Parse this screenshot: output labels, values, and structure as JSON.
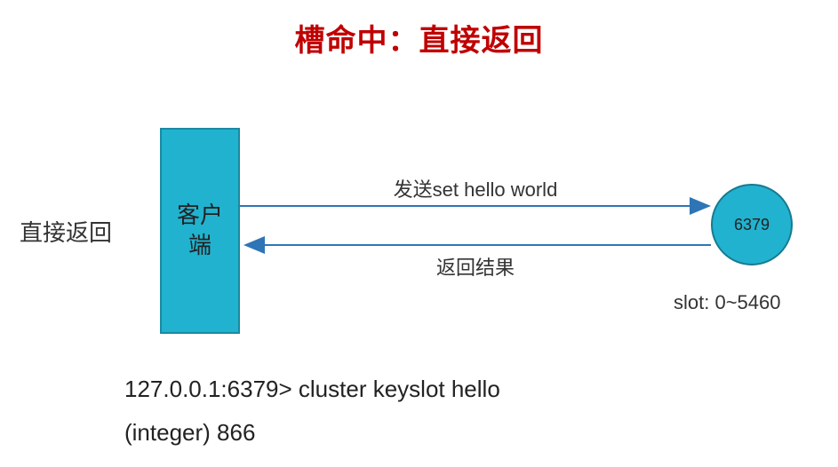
{
  "title": "槽命中：直接返回",
  "left_label": "直接返回",
  "client": {
    "label_line1": "客户",
    "label_line2": "端"
  },
  "node": {
    "port": "6379",
    "slot_range": "slot: 0~5460"
  },
  "arrows": {
    "send": {
      "caption": "发送set hello world"
    },
    "recv": {
      "caption": "返回结果"
    }
  },
  "terminal": {
    "line1": "127.0.0.1:6379> cluster keyslot hello",
    "line2": "(integer) 866"
  },
  "colors": {
    "title": "#c00000",
    "node_fill": "#21b2cf",
    "arrow": "#2e75b6"
  }
}
